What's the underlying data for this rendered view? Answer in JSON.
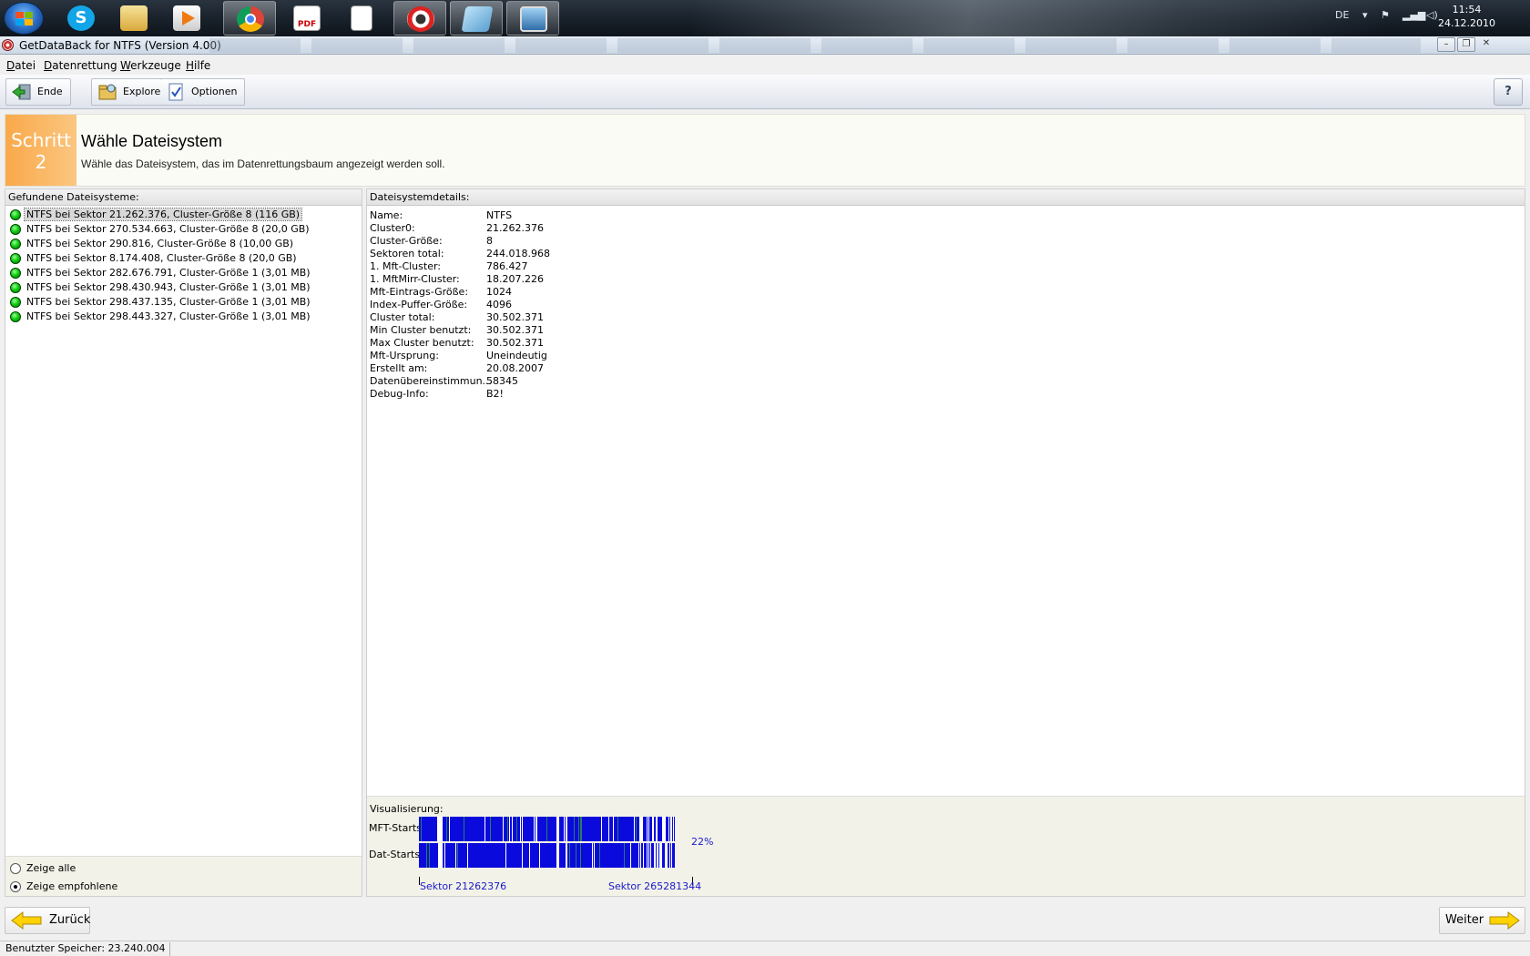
{
  "taskbar": {
    "language": "DE",
    "time": "11:54",
    "date": "24.12.2010"
  },
  "window": {
    "title": "GetDataBack for NTFS (Version 4.00)"
  },
  "menu": {
    "items": [
      {
        "label": "Datei"
      },
      {
        "label": "Datenrettung"
      },
      {
        "label": "Werkzeuge"
      },
      {
        "label": "Hilfe"
      }
    ]
  },
  "toolbar": {
    "exit_label": "Ende",
    "explorer_label": "Explorer",
    "options_label": "Optionen",
    "help_label": "?"
  },
  "step": {
    "badge_word": "Schritt",
    "badge_number": "2",
    "title": "Wähle Dateisystem",
    "subtitle": "Wähle das Dateisystem, das im Datenrettungsbaum angezeigt werden soll."
  },
  "left_pane": {
    "header": "Gefundene Dateisysteme:",
    "items": [
      {
        "label": "NTFS bei Sektor 21.262.376, Cluster-Größe 8 (116 GB)",
        "selected": true
      },
      {
        "label": "NTFS bei Sektor 270.534.663, Cluster-Größe 8 (20,0 GB)"
      },
      {
        "label": "NTFS bei Sektor 290.816, Cluster-Größe 8 (10,00 GB)"
      },
      {
        "label": "NTFS bei Sektor 8.174.408, Cluster-Größe 8 (20,0 GB)"
      },
      {
        "label": "NTFS bei Sektor 282.676.791, Cluster-Größe 1 (3,01 MB)"
      },
      {
        "label": "NTFS bei Sektor 298.430.943, Cluster-Größe 1 (3,01 MB)"
      },
      {
        "label": "NTFS bei Sektor 298.437.135, Cluster-Größe 1 (3,01 MB)"
      },
      {
        "label": "NTFS bei Sektor 298.443.327, Cluster-Größe 1 (3,01 MB)"
      }
    ],
    "show_all_label": "Zeige alle",
    "show_recommended_label": "Zeige empfohlene",
    "selected_radio": "recommended"
  },
  "right_pane": {
    "header": "Dateisystemdetails:",
    "details": [
      {
        "key": "Name:",
        "value": "NTFS"
      },
      {
        "key": "Cluster0:",
        "value": "21.262.376"
      },
      {
        "key": "Cluster-Größe:",
        "value": "8"
      },
      {
        "key": "Sektoren total:",
        "value": "244.018.968"
      },
      {
        "key": "1. Mft-Cluster:",
        "value": "786.427"
      },
      {
        "key": "1. MftMirr-Cluster:",
        "value": "18.207.226"
      },
      {
        "key": "Mft-Eintrags-Größe:",
        "value": "1024"
      },
      {
        "key": "Index-Puffer-Größe:",
        "value": "4096"
      },
      {
        "key": "Cluster total:",
        "value": "30.502.371"
      },
      {
        "key": "Min Cluster benutzt:",
        "value": "30.502.371"
      },
      {
        "key": "Max Cluster benutzt:",
        "value": "30.502.371"
      },
      {
        "key": "Mft-Ursprung:",
        "value": "Uneindeutig"
      },
      {
        "key": "Erstellt am:",
        "value": "20.08.2007"
      },
      {
        "key": "Datenübereinstimmun...",
        "value": "58345"
      },
      {
        "key": "Debug-Info:",
        "value": "B2!"
      }
    ]
  },
  "visualization": {
    "label": "Visualisierung:",
    "mft_label": "MFT-Starts:",
    "dat_label": "Dat-Starts:",
    "percent": "22%",
    "sector_start": "Sektor 21262376",
    "sector_end": "Sektor 265281344",
    "colors": {
      "fill": "#0a0adc",
      "accent": "#2a7a6a",
      "gap": "#ffffff"
    }
  },
  "navigation": {
    "back_label": "Zurück",
    "next_label": "Weiter"
  },
  "status": {
    "memory": "Benutzter Speicher: 23.240.004"
  }
}
